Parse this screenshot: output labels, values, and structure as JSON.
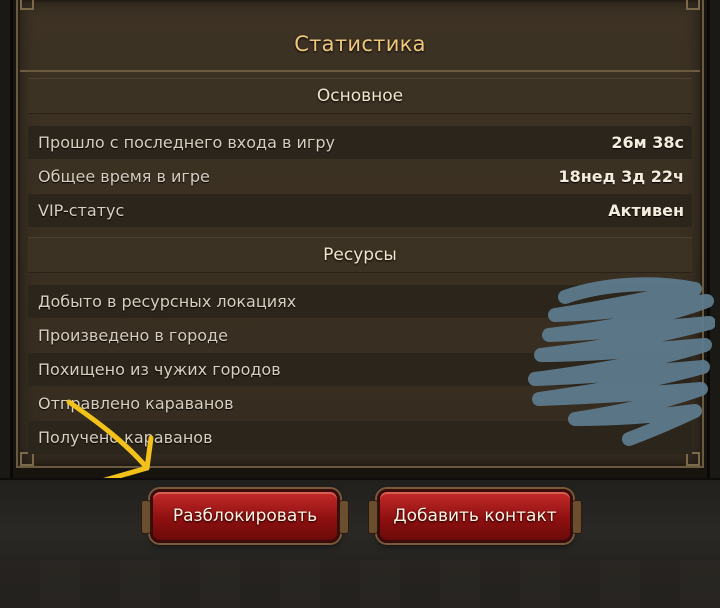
{
  "header": {
    "title": "Статистика"
  },
  "sections": {
    "main": {
      "title": "Основное",
      "rows": [
        {
          "label": "Прошло с последнего входа в игру",
          "value": "26м 38с"
        },
        {
          "label": "Общее время в игре",
          "value": "18нед 3д 22ч"
        },
        {
          "label": "VIP-статус",
          "value": "Активен"
        }
      ]
    },
    "resources": {
      "title": "Ресурсы",
      "rows": [
        {
          "label": "Добыто в ресурсных локациях"
        },
        {
          "label": "Произведено в городе"
        },
        {
          "label": "Похищено из чужих городов"
        },
        {
          "label": "Отправлено караванов"
        },
        {
          "label": "Получено караванов"
        }
      ]
    }
  },
  "buttons": {
    "unblock": "Разблокировать",
    "add_contact": "Добавить контакт"
  },
  "colors": {
    "title": "#efc77e",
    "button_red": "#b01f1f",
    "annotation_arrow": "#f2c21b",
    "censor_scribble": "#5d7a8c"
  },
  "icons": [
    "hand-drawn-arrow",
    "censor-scribble"
  ]
}
